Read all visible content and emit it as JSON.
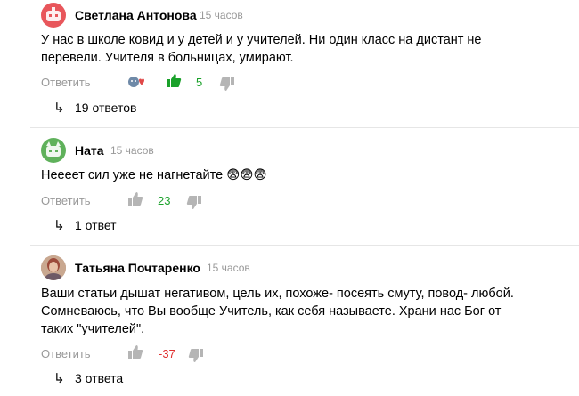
{
  "comments": [
    {
      "author": "Светлана Антонова",
      "time": "15 часов",
      "lines": [
        "У нас в школе ковид и у детей и у учителей. Ни один класс на дистант не",
        "перевели. Учителя в больницах, умирают."
      ],
      "reply_label": "Ответить",
      "likes": "5",
      "replies": "19 ответов",
      "avatar_color": "#e8565b",
      "count_color": "#1aa12a",
      "liked": true,
      "has_reactions": true
    },
    {
      "author": "Ната",
      "time": "15 часов",
      "lines": [
        "Неееет сил уже не нагнетайте 😨😨😨"
      ],
      "reply_label": "Ответить",
      "likes": "23",
      "replies": "1 ответ",
      "avatar_color": "#5fb15b",
      "count_color": "#1aa12a",
      "liked": false,
      "has_reactions": false
    },
    {
      "author": "Татьяна Почтаренко",
      "time": "15 часов",
      "lines": [
        "Ваши статьи дышат негативом, цель их, похоже- посеять смуту, повод- любой.",
        "Сомневаюсь, что Вы вообще Учитель, как себя называете. Храни нас Бог от",
        "таких \"учителей\"."
      ],
      "reply_label": "Ответить",
      "likes": "-37",
      "replies": "3 ответа",
      "avatar_color": "#b89a86",
      "count_color": "#e03030",
      "liked": false,
      "has_reactions": false
    }
  ],
  "icons": {
    "reply_arrow": "↳"
  }
}
